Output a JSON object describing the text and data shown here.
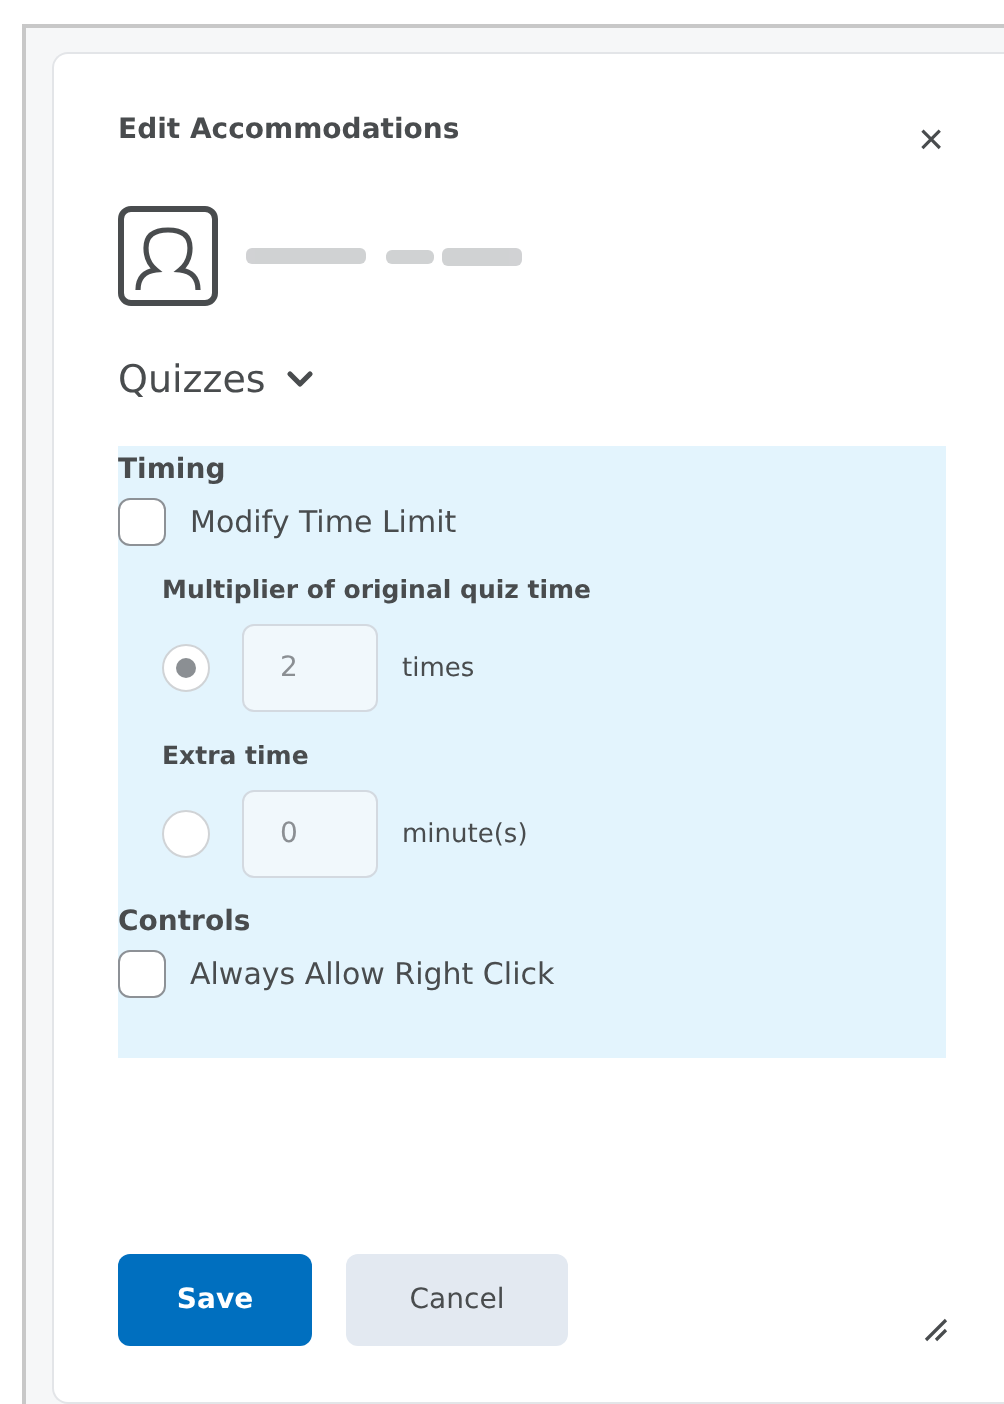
{
  "dialog": {
    "title": "Edit Accommodations",
    "close": "×"
  },
  "section": {
    "title": "Quizzes",
    "expanded": true
  },
  "panel": {
    "groups": [
      {
        "kind": "timing",
        "title": "Timing",
        "checkbox": {
          "label": "Modify Time Limit",
          "checked": false
        },
        "options": [
          {
            "label": "Multiplier of original quiz time",
            "selected": true,
            "value": "2",
            "unit": "times"
          },
          {
            "label": "Extra time",
            "selected": false,
            "value": "0",
            "unit": "minute(s)"
          }
        ]
      },
      {
        "kind": "controls",
        "title": "Controls",
        "checkbox": {
          "label": "Always Allow Right Click",
          "checked": false
        }
      }
    ]
  },
  "buttons": [
    {
      "label": "Save",
      "kind": "primary"
    },
    {
      "label": "Cancel",
      "kind": "secondary"
    }
  ]
}
